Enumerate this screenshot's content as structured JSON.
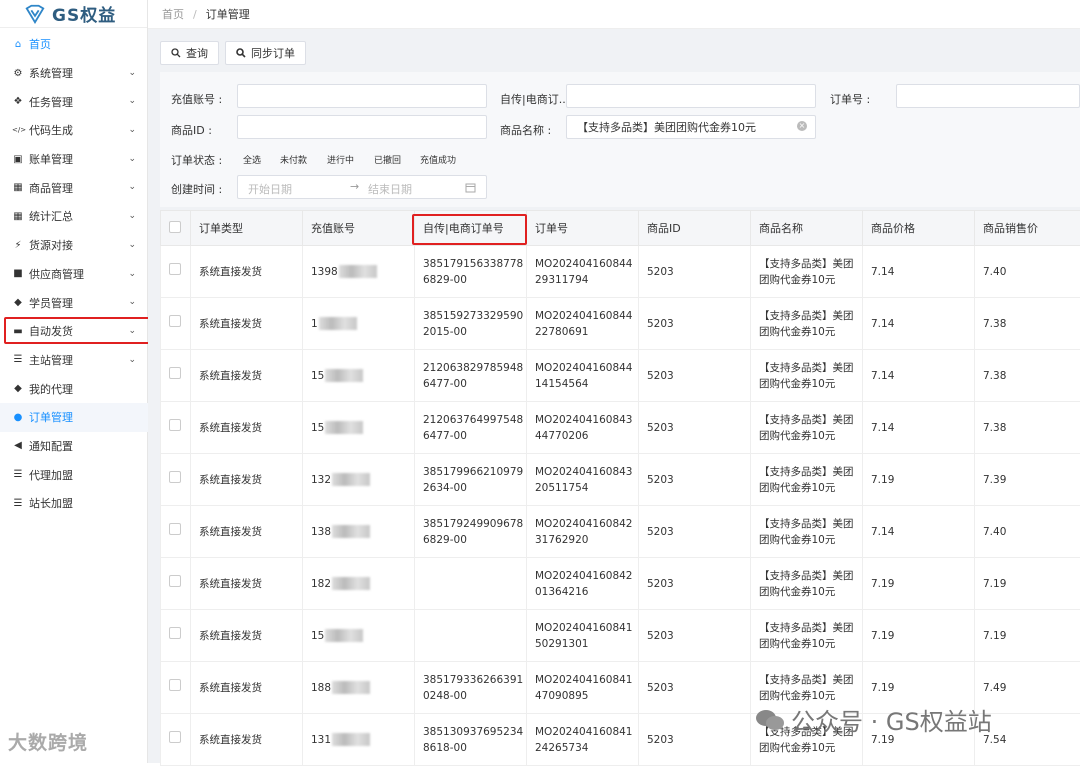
{
  "app": {
    "title": "GS权益"
  },
  "breadcrumb": {
    "home": "首页",
    "separator": "/",
    "current": "订单管理"
  },
  "sidebar": {
    "items": [
      {
        "label": "首页",
        "icon": "home-icon",
        "chevron": false
      },
      {
        "label": "系统管理",
        "icon": "gear-icon",
        "chevron": true
      },
      {
        "label": "任务管理",
        "icon": "cubes-icon",
        "chevron": true
      },
      {
        "label": "代码生成",
        "icon": "code-icon",
        "chevron": true
      },
      {
        "label": "账单管理",
        "icon": "bill-icon",
        "chevron": true
      },
      {
        "label": "商品管理",
        "icon": "calendar-icon",
        "chevron": true
      },
      {
        "label": "统计汇总",
        "icon": "grid-icon",
        "chevron": true
      },
      {
        "label": "货源对接",
        "icon": "plug-icon",
        "chevron": true
      },
      {
        "label": "供应商管理",
        "icon": "archive-icon",
        "chevron": true
      },
      {
        "label": "学员管理",
        "icon": "tag-icon",
        "chevron": true
      },
      {
        "label": "自动发货",
        "icon": "car-icon",
        "chevron": true
      },
      {
        "label": "主站管理",
        "icon": "list-icon",
        "chevron": true
      },
      {
        "label": "我的代理",
        "icon": "tag-icon",
        "chevron": false
      },
      {
        "label": "订单管理",
        "icon": "circle-icon",
        "chevron": false
      },
      {
        "label": "通知配置",
        "icon": "bullhorn-icon",
        "chevron": false
      },
      {
        "label": "代理加盟",
        "icon": "list-icon",
        "chevron": false
      },
      {
        "label": "站长加盟",
        "icon": "list-icon",
        "chevron": false
      }
    ]
  },
  "toolbar": {
    "query_label": "查询",
    "sync_label": "同步订单"
  },
  "filters": {
    "recharge_account_label": "充值账号 :",
    "self_order_label": "自传|电商订...",
    "order_no_label": "订单号 :",
    "product_id_label": "商品ID :",
    "product_name_label": "商品名称 :",
    "product_name_value": "【支持多品类】美团团购代金券10元",
    "status_label": "订单状态 :",
    "statuses": [
      "全选",
      "未付款",
      "进行中",
      "已撤回",
      "充值成功"
    ],
    "created_label": "创建时间 :",
    "start_placeholder": "开始日期",
    "range_arrow": "→",
    "end_placeholder": "结束日期"
  },
  "table": {
    "headers": [
      "订单类型",
      "充值账号",
      "自传|电商订单号",
      "订单号",
      "商品ID",
      "商品名称",
      "商品价格",
      "商品销售价"
    ],
    "rows": [
      {
        "type": "系统直接发货",
        "account": "1398",
        "ext": "3851791563387786829-00",
        "order": "MO20240416084429311794",
        "pid": "5203",
        "name": "【支持多品类】美团团购代金券10元",
        "price": "7.14",
        "sale": "7.40"
      },
      {
        "type": "系统直接发货",
        "account": "1",
        "ext": "3851592733295902015-00",
        "order": "MO20240416084422780691",
        "pid": "5203",
        "name": "【支持多品类】美团团购代金券10元",
        "price": "7.14",
        "sale": "7.38"
      },
      {
        "type": "系统直接发货",
        "account": "15",
        "ext": "2120638297859486477-00",
        "order": "MO20240416084414154564",
        "pid": "5203",
        "name": "【支持多品类】美团团购代金券10元",
        "price": "7.14",
        "sale": "7.38"
      },
      {
        "type": "系统直接发货",
        "account": "15",
        "ext": "2120637649975486477-00",
        "order": "MO20240416084344770206",
        "pid": "5203",
        "name": "【支持多品类】美团团购代金券10元",
        "price": "7.14",
        "sale": "7.38"
      },
      {
        "type": "系统直接发货",
        "account": "132",
        "ext": "3851799662109792634-00",
        "order": "MO20240416084320511754",
        "pid": "5203",
        "name": "【支持多品类】美团团购代金券10元",
        "price": "7.19",
        "sale": "7.39"
      },
      {
        "type": "系统直接发货",
        "account": "138",
        "ext": "3851792499096786829-00",
        "order": "MO20240416084231762920",
        "pid": "5203",
        "name": "【支持多品类】美团团购代金券10元",
        "price": "7.14",
        "sale": "7.40"
      },
      {
        "type": "系统直接发货",
        "account": "182",
        "ext": "",
        "order": "MO20240416084201364216",
        "pid": "5203",
        "name": "【支持多品类】美团团购代金券10元",
        "price": "7.19",
        "sale": "7.19"
      },
      {
        "type": "系统直接发货",
        "account": "15",
        "ext": "",
        "order": "MO20240416084150291301",
        "pid": "5203",
        "name": "【支持多品类】美团团购代金券10元",
        "price": "7.19",
        "sale": "7.19"
      },
      {
        "type": "系统直接发货",
        "account": "188",
        "ext": "3851793362663910248-00",
        "order": "MO20240416084147090895",
        "pid": "5203",
        "name": "【支持多品类】美团团购代金券10元",
        "price": "7.19",
        "sale": "7.49"
      },
      {
        "type": "系统直接发货",
        "account": "131",
        "ext": "3851309376952348618-00",
        "order": "MO20240416084124265734",
        "pid": "5203",
        "name": "【支持多品类】美团团购代金券10元",
        "price": "7.19",
        "sale": "7.54"
      }
    ]
  },
  "watermarks": {
    "left": "大数跨境",
    "right": "公众号 · GS权益站"
  },
  "colors": {
    "accent": "#1890ff",
    "highlight": "#e02020"
  }
}
